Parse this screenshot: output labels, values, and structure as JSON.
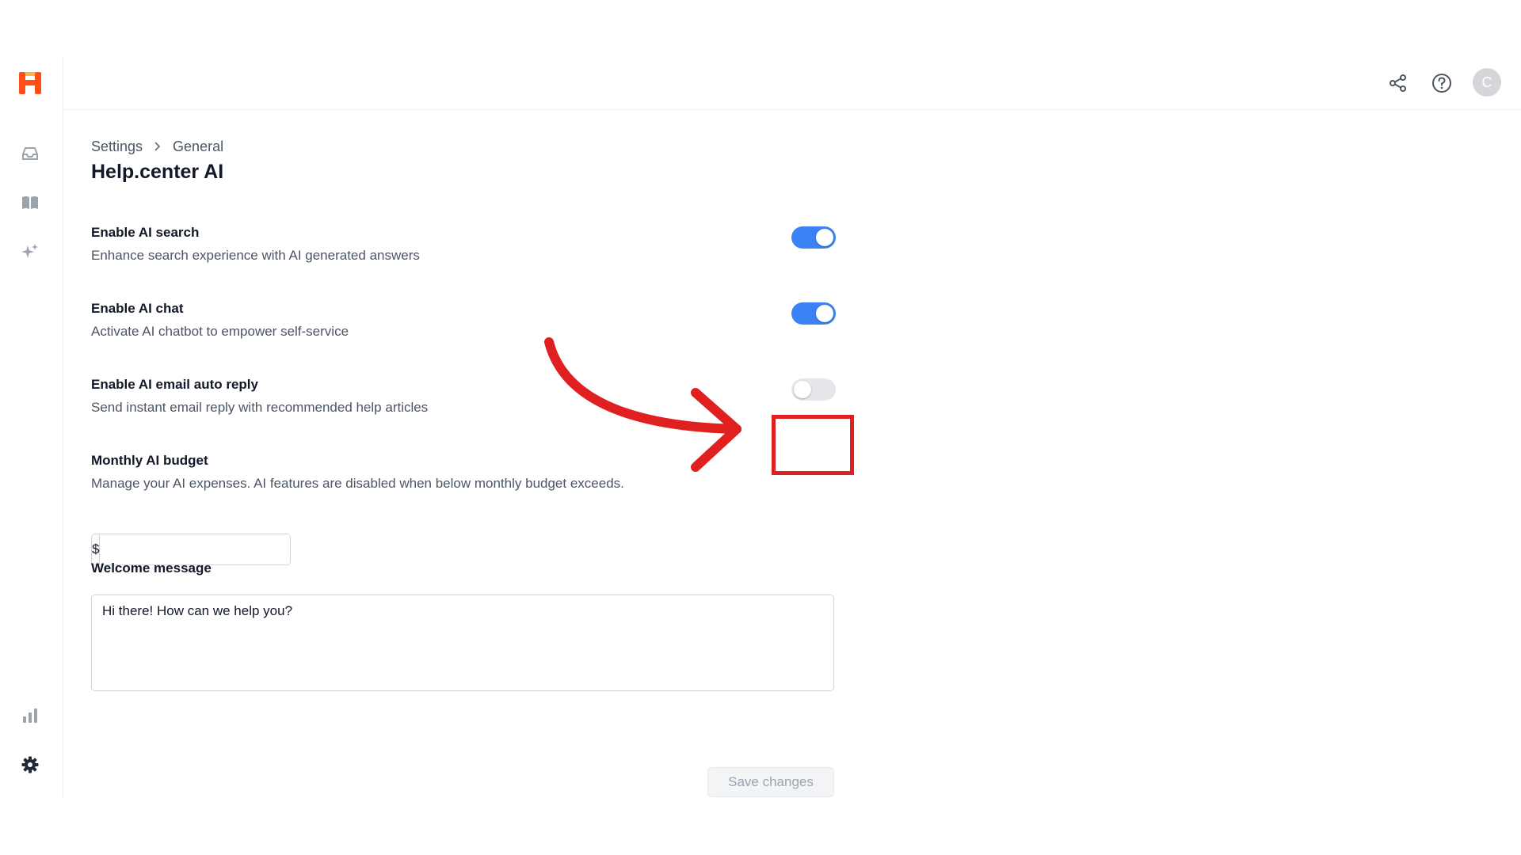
{
  "sidebar": {
    "logo_letter": "H",
    "brand_color": "#ff4f17",
    "items": [
      {
        "name": "inbox",
        "icon": "inbox-icon"
      },
      {
        "name": "knowledge-base",
        "icon": "book-icon"
      },
      {
        "name": "ai",
        "icon": "sparkles-icon"
      },
      {
        "name": "reports",
        "icon": "bar-chart-icon"
      },
      {
        "name": "settings",
        "icon": "gear-icon"
      }
    ]
  },
  "header": {
    "icons": [
      "share-icon",
      "help-icon"
    ],
    "avatar_initial": "C"
  },
  "breadcrumb": {
    "root": "Settings",
    "current": "General"
  },
  "page": {
    "title": "Help.center AI"
  },
  "settings": {
    "ai_search": {
      "title": "Enable AI search",
      "description": "Enhance search experience with AI generated answers",
      "enabled": true
    },
    "ai_chat": {
      "title": "Enable AI chat",
      "description": "Activate AI chatbot to empower self-service",
      "enabled": true
    },
    "ai_email": {
      "title": "Enable AI email auto reply",
      "description": "Send instant email reply with recommended help articles",
      "enabled": false
    },
    "budget": {
      "title": "Monthly AI budget",
      "description": "Manage your AI expenses. AI features are disabled when below monthly budget exceeds.",
      "prefix": "$",
      "value": ""
    },
    "welcome": {
      "title": "Welcome message",
      "value": "Hi there! How can we help you?"
    }
  },
  "actions": {
    "save_label": "Save changes"
  },
  "colors": {
    "toggle_on": "#3b82f6",
    "toggle_off": "#e5e7eb",
    "annotation": "#e02020"
  }
}
